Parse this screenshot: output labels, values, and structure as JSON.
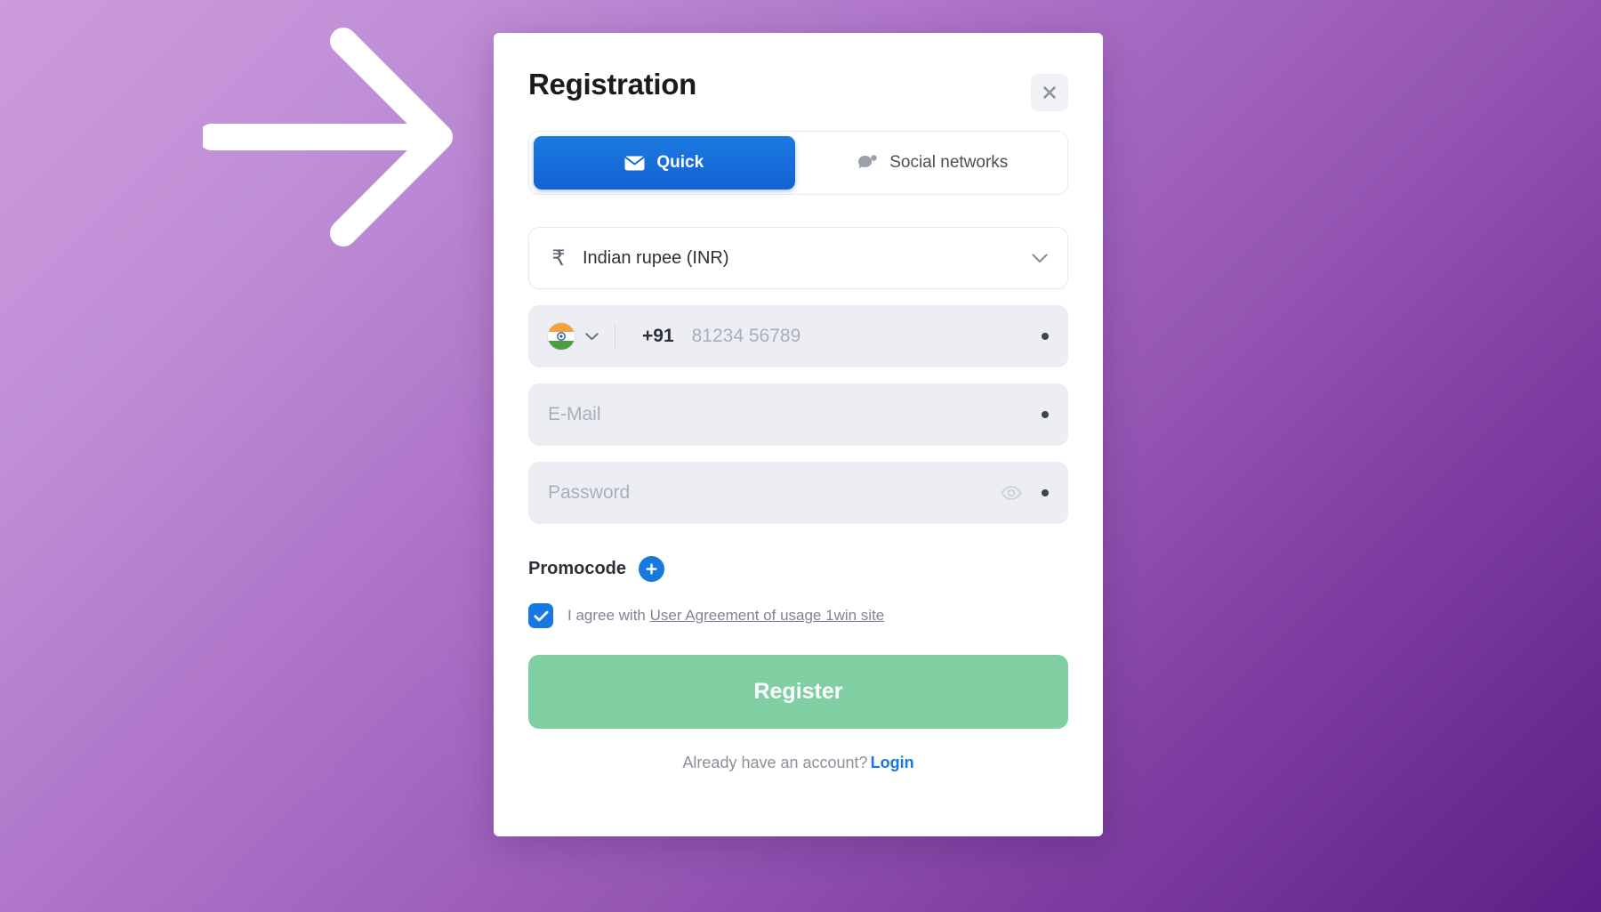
{
  "annotation": {
    "arrow": "arrow-right"
  },
  "card": {
    "title": "Registration",
    "close_label": "×"
  },
  "tabs": [
    {
      "label": "Quick",
      "icon": "envelope-icon",
      "active": true
    },
    {
      "label": "Social networks",
      "icon": "chat-bubble-icon",
      "active": false
    }
  ],
  "currency": {
    "symbol": "₹",
    "label": "Indian rupee (INR)",
    "chevron": "chevron-down-icon"
  },
  "phone": {
    "flag": "india-flag-icon",
    "chevron": "chevron-down-icon",
    "prefix": "+91",
    "placeholder": "81234 56789",
    "value": ""
  },
  "email": {
    "placeholder": "E-Mail",
    "value": ""
  },
  "password": {
    "placeholder": "Password",
    "value": "",
    "toggle_icon": "eye-icon"
  },
  "promocode": {
    "label": "Promocode",
    "add_icon": "plus-icon"
  },
  "agreement": {
    "checked": true,
    "prefix": "I agree with ",
    "link_text": "User Agreement of usage 1win site"
  },
  "submit": {
    "label": "Register"
  },
  "footer": {
    "text": "Already have an account?",
    "login_label": "Login"
  },
  "colors": {
    "accent_blue": "#1778e0",
    "register_green": "#7fcfa3",
    "background_start": "#cd9bdc",
    "background_end": "#5d1f87",
    "field_bg": "#eceef4"
  }
}
